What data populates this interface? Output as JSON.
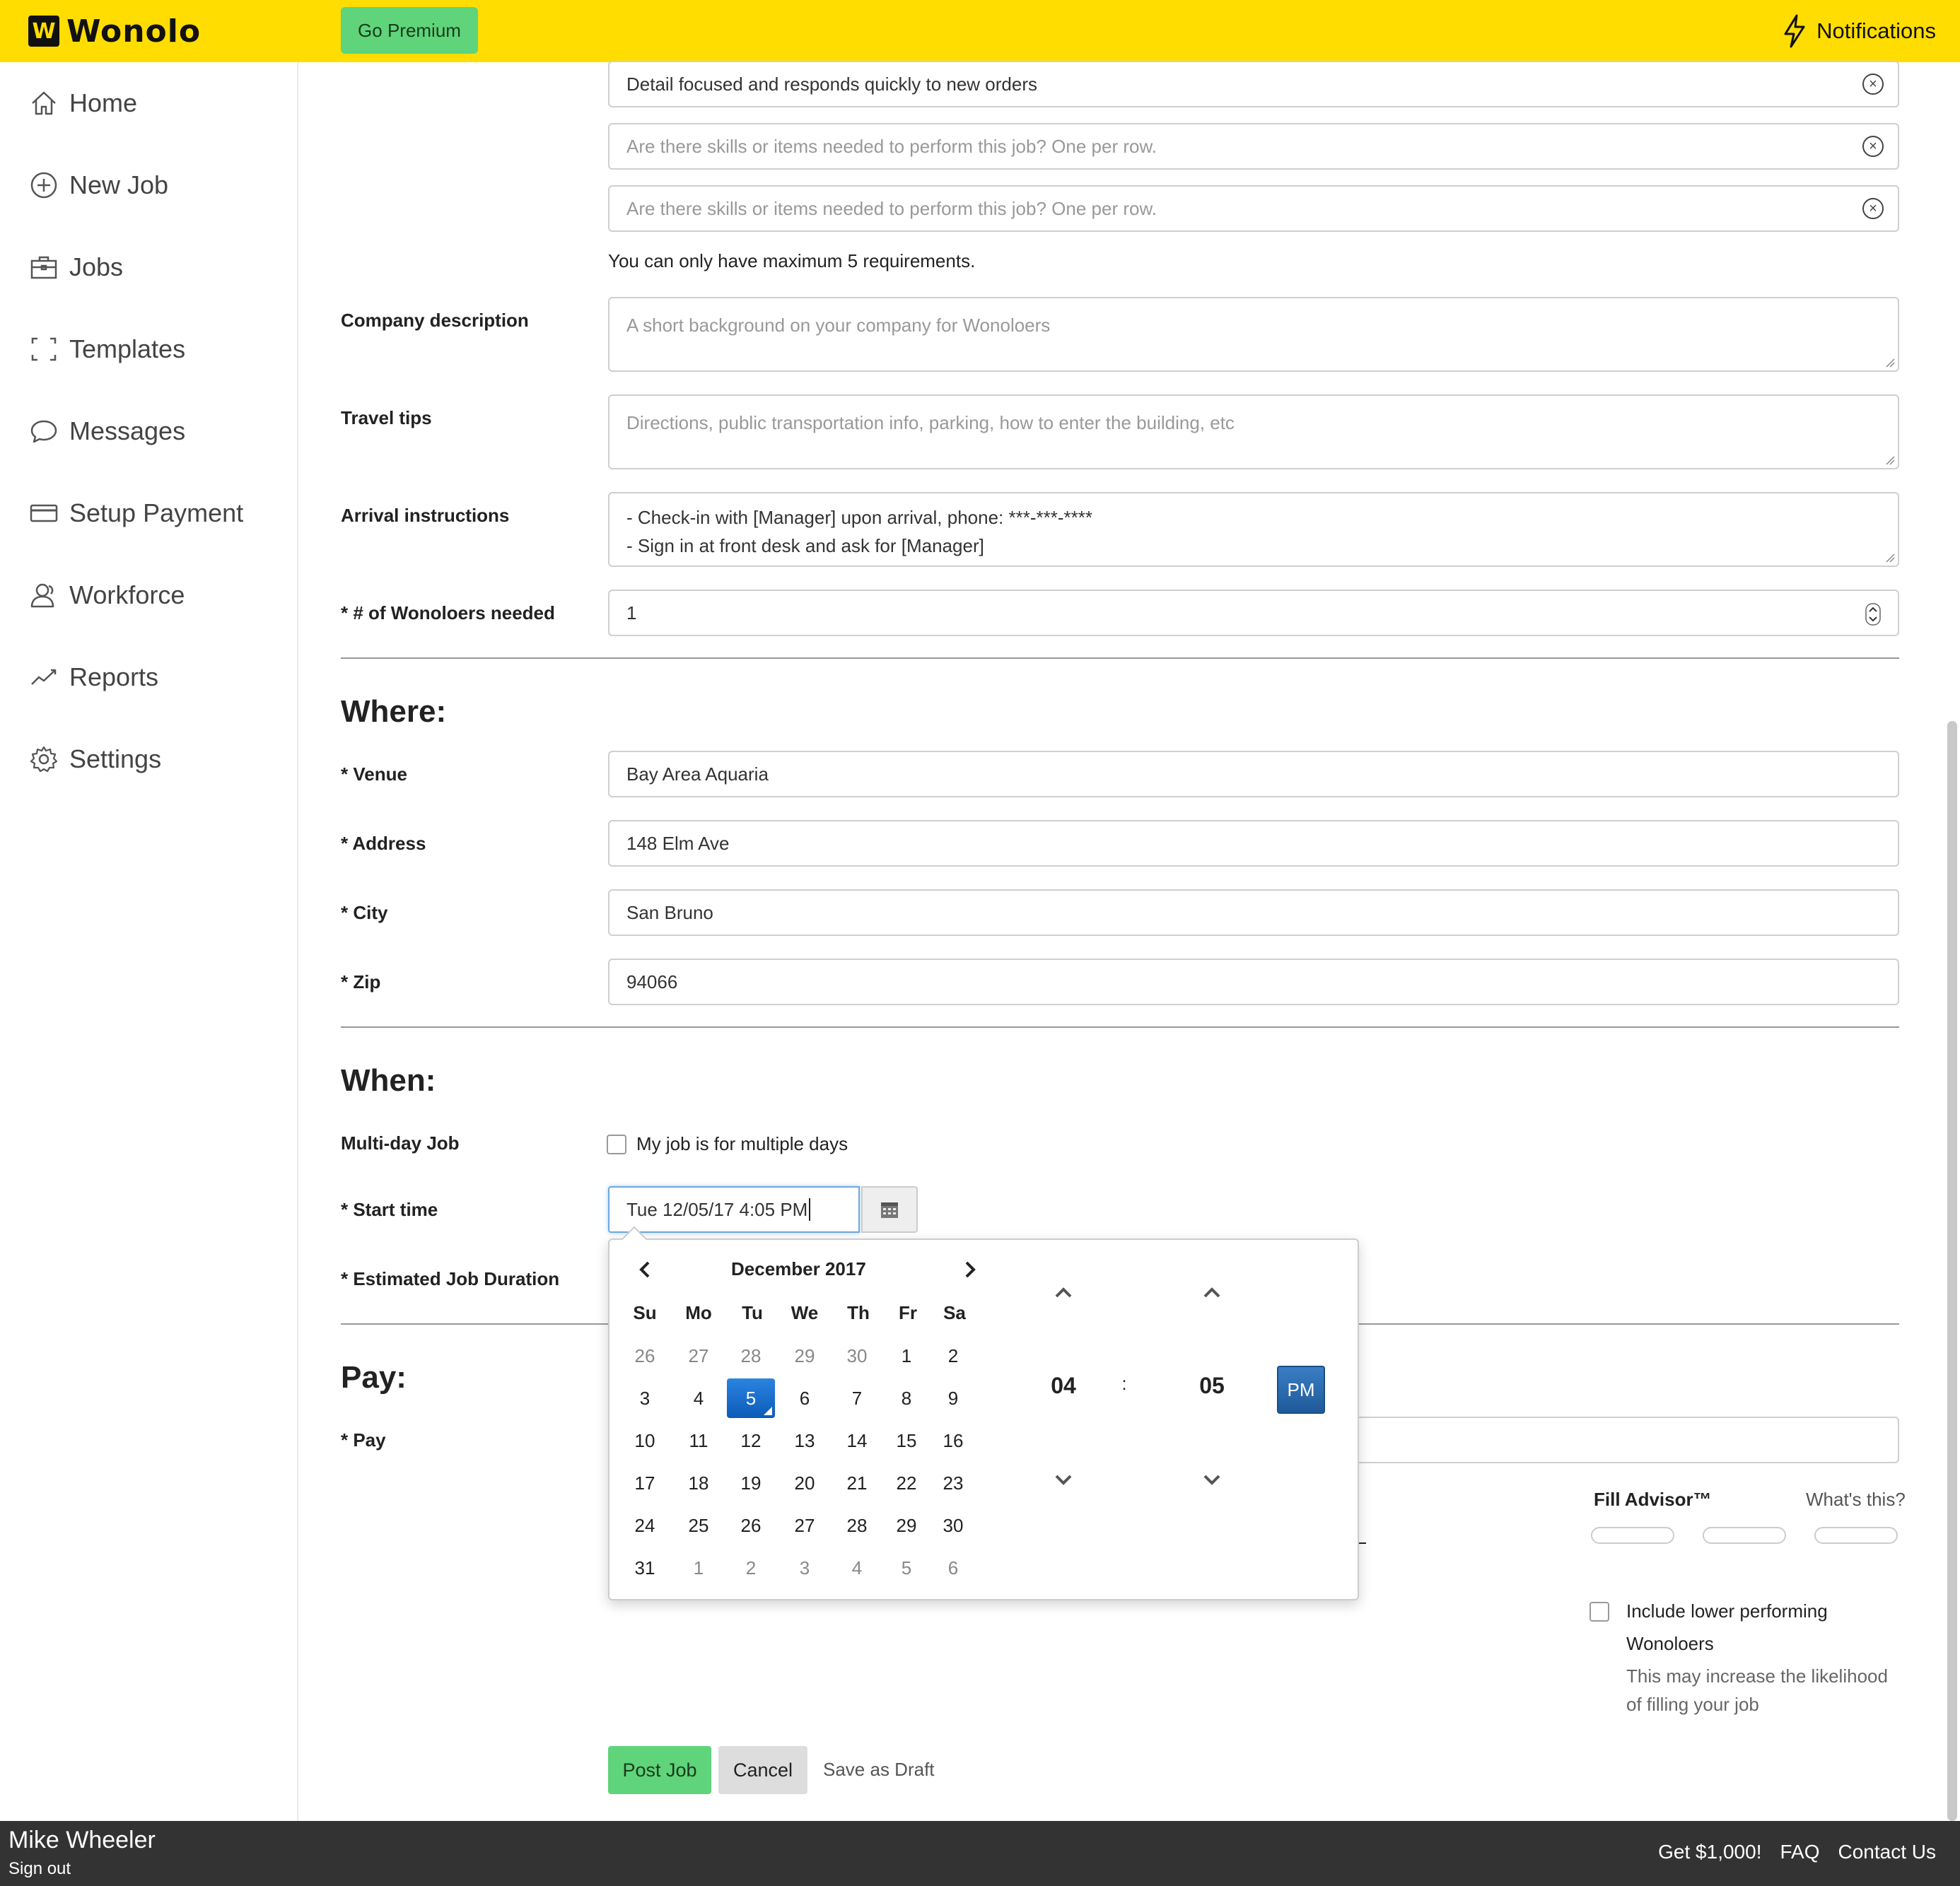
{
  "header": {
    "logo_mark": "W",
    "logo_text": "Wonolo",
    "premium_label": "Go Premium",
    "notifications_label": "Notifications"
  },
  "sidebar": {
    "items": [
      {
        "label": "Home",
        "icon": "home-icon"
      },
      {
        "label": "New Job",
        "icon": "plus-circle-icon"
      },
      {
        "label": "Jobs",
        "icon": "briefcase-icon"
      },
      {
        "label": "Templates",
        "icon": "templates-icon"
      },
      {
        "label": "Messages",
        "icon": "chat-bubble-icon"
      },
      {
        "label": "Setup Payment",
        "icon": "credit-card-icon"
      },
      {
        "label": "Workforce",
        "icon": "users-icon"
      },
      {
        "label": "Reports",
        "icon": "trend-line-icon"
      },
      {
        "label": "Settings",
        "icon": "gear-icon"
      }
    ]
  },
  "requirements": {
    "items": [
      {
        "value": "Detail focused and responds quickly to new orders",
        "placeholder": ""
      },
      {
        "value": "",
        "placeholder": "Are there skills or items needed to perform this job? One per row."
      },
      {
        "value": "",
        "placeholder": "Are there skills or items needed to perform this job? One per row."
      }
    ],
    "max_note": "You can only have maximum 5 requirements."
  },
  "company_description": {
    "label": "Company description",
    "placeholder": "A short background on your company for Wonoloers"
  },
  "travel_tips": {
    "label": "Travel tips",
    "placeholder": "Directions, public transportation info, parking, how to enter the building, etc"
  },
  "arrival_instructions": {
    "label": "Arrival instructions",
    "line1": "- Check-in with [Manager] upon arrival, phone: ***-***-****",
    "line2": "- Sign in at front desk and ask for [Manager]"
  },
  "wonoloers_needed": {
    "label": "* # of Wonoloers needed",
    "value": "1"
  },
  "where": {
    "title": "Where:",
    "venue_label": "* Venue",
    "venue_value": "Bay Area Aquaria",
    "address_label": "* Address",
    "address_value": "148 Elm Ave",
    "city_label": "* City",
    "city_value": "San Bruno",
    "zip_label": "* Zip",
    "zip_value": "94066"
  },
  "when": {
    "title": "When:",
    "multiday_label": "Multi-day Job",
    "multiday_checkbox_label": "My job is for multiple days",
    "start_label": "* Start time",
    "start_value": "Tue 12/05/17 4:05 PM",
    "duration_label": "* Estimated Job Duration"
  },
  "datepicker": {
    "month_label": "December 2017",
    "weekdays": [
      "Su",
      "Mo",
      "Tu",
      "We",
      "Th",
      "Fr",
      "Sa"
    ],
    "weeks": [
      [
        "26",
        "27",
        "28",
        "29",
        "30",
        "1",
        "2"
      ],
      [
        "3",
        "4",
        "5",
        "6",
        "7",
        "8",
        "9"
      ],
      [
        "10",
        "11",
        "12",
        "13",
        "14",
        "15",
        "16"
      ],
      [
        "17",
        "18",
        "19",
        "20",
        "21",
        "22",
        "23"
      ],
      [
        "24",
        "25",
        "26",
        "27",
        "28",
        "29",
        "30"
      ],
      [
        "31",
        "1",
        "2",
        "3",
        "4",
        "5",
        "6"
      ]
    ],
    "selected_day": "5",
    "hour": "04",
    "separator": ":",
    "minute": "05",
    "meridiem": "PM"
  },
  "pay": {
    "title": "Pay:",
    "pay_label": "* Pay"
  },
  "fill_advisor": {
    "title": "Fill Advisor™",
    "help_link": "What's this?",
    "include_label_line1": "Include lower performing",
    "include_label_line2": "Wonoloers",
    "hint_line1": "This may increase the likelihood",
    "hint_line2": "of filling your job"
  },
  "actions": {
    "post_label": "Post Job",
    "cancel_label": "Cancel",
    "draft_label": "Save as Draft"
  },
  "footer": {
    "user_name": "Mike Wheeler",
    "signout_label": "Sign out",
    "referral_label": "Get $1,000!",
    "faq_label": "FAQ",
    "contact_label": "Contact Us"
  },
  "colors": {
    "brand_yellow": "#ffdd00",
    "premium_green": "#5fd47a",
    "selected_blue": "#1a6fd4",
    "footer_dark": "#333333"
  }
}
